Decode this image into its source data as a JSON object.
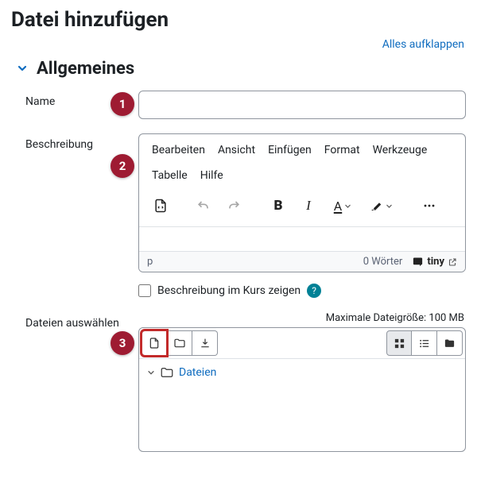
{
  "page_title": "Datei hinzufügen",
  "expand_all": "Alles aufklappen",
  "section": {
    "title": "Allgemeines"
  },
  "fields": {
    "name": {
      "label": "Name",
      "value": ""
    },
    "description": {
      "label": "Beschreibung",
      "menu": [
        "Bearbeiten",
        "Ansicht",
        "Einfügen",
        "Format",
        "Werkzeuge",
        "Tabelle",
        "Hilfe"
      ],
      "status_path": "p",
      "word_count": "0 Wörter",
      "branding": "tiny"
    },
    "show_desc": {
      "label": "Beschreibung im Kurs zeigen",
      "checked": false
    },
    "files": {
      "label": "Dateien auswählen",
      "max_size": "Maximale Dateigröße: 100 MB",
      "path_root": "Dateien"
    }
  },
  "markers": {
    "m1": "1",
    "m2": "2",
    "m3": "3"
  }
}
